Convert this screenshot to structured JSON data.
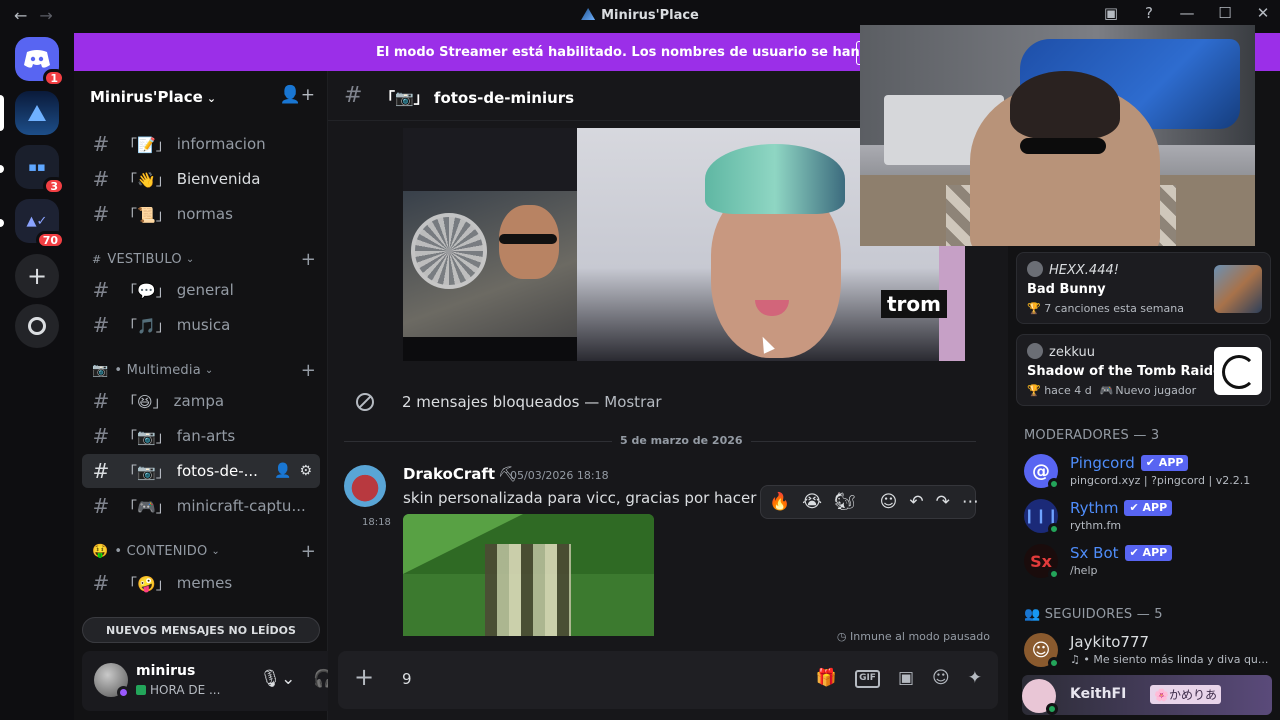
{
  "window": {
    "title": "Minirus'Place"
  },
  "rail": {
    "home_badge": "1",
    "servers": [
      {
        "badge": ""
      },
      {
        "badge": "3"
      },
      {
        "badge": "70"
      }
    ]
  },
  "banner": {
    "text": "El modo Streamer está habilitado. Los nombres de usuario se han truncado."
  },
  "guild": {
    "name": "Minirus'Place"
  },
  "channels": {
    "top": [
      {
        "name": "informacion",
        "emoji": "📝"
      },
      {
        "name": "Bienvenida",
        "emoji": "👋"
      },
      {
        "name": "normas",
        "emoji": "📜"
      }
    ],
    "cat_vestibulo": "VESTIBULO",
    "vestibulo": [
      {
        "name": "general",
        "emoji": "💬"
      },
      {
        "name": "musica",
        "emoji": "🎵"
      }
    ],
    "cat_multimedia": "Multimedia",
    "multimedia": [
      {
        "name": "zampa",
        "emoji": "😆"
      },
      {
        "name": "fan-arts",
        "emoji": "📷"
      },
      {
        "name": "fotos-de-...",
        "emoji": "📷"
      },
      {
        "name": "minicraft-captu...",
        "emoji": "🎮"
      }
    ],
    "cat_contenido": "CONTENIDO",
    "contenido": [
      {
        "name": "memes",
        "emoji": "🤪"
      }
    ],
    "unread_pill": "NUEVOS MENSAJES NO LEÍDOS"
  },
  "user": {
    "name": "minirus",
    "status": "HORA DE ..."
  },
  "chat": {
    "channel": "fotos-de-miniurs",
    "channel_prefix": "「📷」",
    "image_logo": "trom",
    "blocked_text": "2 mensajes bloqueados —",
    "blocked_show": "Mostrar",
    "divider_date": "5 de marzo de 2026",
    "message": {
      "author": "DrakoCraft",
      "author_suffix": "⛏",
      "date": "05/03/2026 18:18",
      "time": "18:18",
      "text": "skin personalizada para vicc, gracias por hacer uno"
    },
    "reactions": [
      "🔥",
      "😭",
      "🐿"
    ],
    "immune_text": "Inmune al modo pausado",
    "composer_value": "9"
  },
  "activities": [
    {
      "user": "HEXX.444!",
      "title": "Bad Bunny",
      "sub": "7 canciones esta semana",
      "sub2": ""
    },
    {
      "user": "zekkuu",
      "title": "Shadow of the Tomb Raider",
      "sub": "hace 4 d",
      "sub2": "Nuevo jugador"
    }
  ],
  "members": {
    "mods_header": "MODERADORES — 3",
    "mods": [
      {
        "name": "Pingcord",
        "tag": "✔ APP",
        "sub": "pingcord.xyz | ?pingcord | v2.2.1",
        "color": "#5865f2"
      },
      {
        "name": "Rythm",
        "tag": "✔ APP",
        "sub": "rythm.fm",
        "color": "#1b2a78"
      },
      {
        "name": "Sx Bot",
        "tag": "✔ APP",
        "sub": "/help",
        "color": "#1a0c0c"
      }
    ],
    "followers_header": "SEGUIDORES — 5",
    "followers": [
      {
        "name": "Jaykito777",
        "sub": "♫ • Me siento más linda y diva qu..."
      }
    ],
    "keith": {
      "name": "KeithFI",
      "badge": "🌸かめりあ"
    }
  }
}
